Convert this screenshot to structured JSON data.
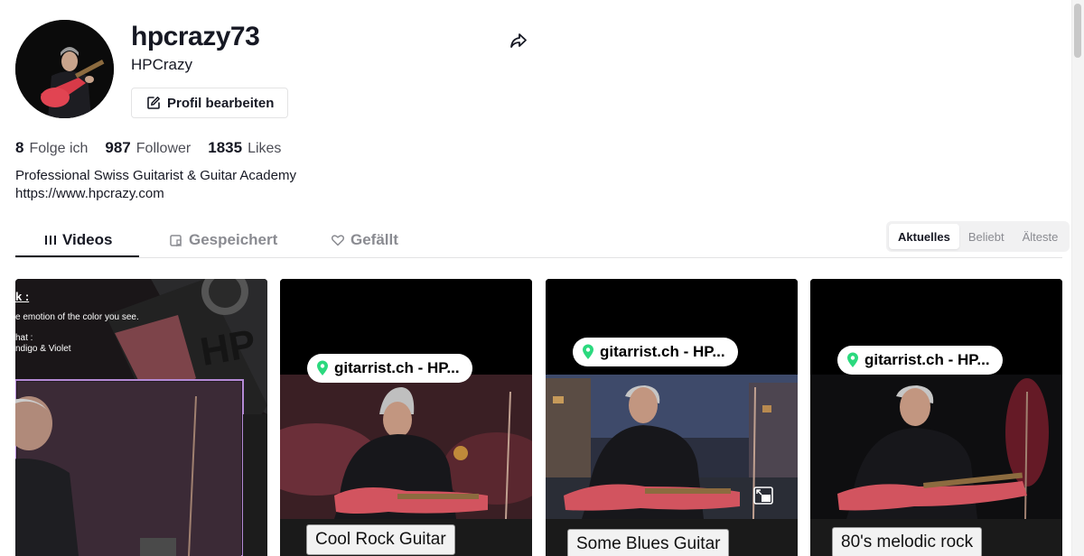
{
  "profile": {
    "username": "hpcrazy73",
    "nickname": "HPCrazy",
    "edit_label": "Profil bearbeiten",
    "bio": "Professional Swiss Guitarist & Guitar Academy",
    "link": "https://www.hpcrazy.com"
  },
  "stats": [
    {
      "value": "8",
      "label": "Folge ich"
    },
    {
      "value": "987",
      "label": "Follower"
    },
    {
      "value": "1835",
      "label": "Likes"
    }
  ],
  "tabs": [
    {
      "label": "Videos",
      "icon": "grid-icon",
      "active": true
    },
    {
      "label": "Gespeichert",
      "icon": "bookmark-icon",
      "active": false
    },
    {
      "label": "Gefällt",
      "icon": "heart-icon",
      "active": false
    }
  ],
  "sort": {
    "options": [
      "Aktuelles",
      "Beliebt",
      "Älteste"
    ],
    "selected": "Aktuelles"
  },
  "videos": [
    {
      "overlay_lines": [
        "k :",
        "e emotion of the color you see.",
        "hat :",
        "ndigo & Violet"
      ],
      "watermark": "HP"
    },
    {
      "location": "gitarrist.ch - HP...",
      "caption": "Cool Rock Guitar"
    },
    {
      "location": "gitarrist.ch - HP...",
      "caption": "Some Blues Guitar"
    },
    {
      "location": "gitarrist.ch - HP...",
      "caption": "80's melodic rock"
    }
  ],
  "colors": {
    "text": "#161823",
    "muted": "#8a8b91",
    "border": "#e3e3e4",
    "location_pin": "#2bd97e"
  }
}
